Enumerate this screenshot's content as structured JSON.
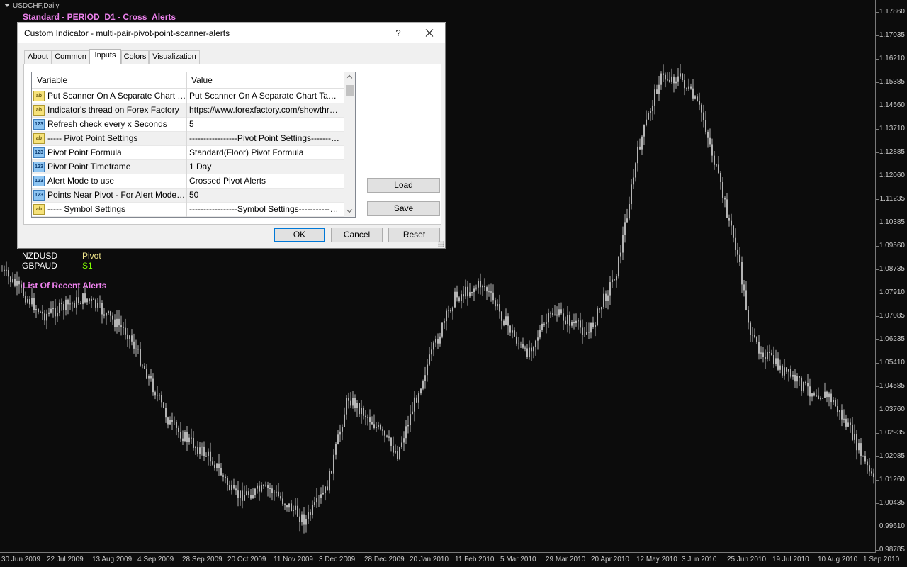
{
  "chart": {
    "symbol_tab": "USDCHF,Daily",
    "indicator_title": "Standard - PERIOD_D1 - Cross_Alerts",
    "scanner_rows": [
      {
        "symbol": "NZDUSD",
        "level": "Pivot",
        "level_color": "#f0e68c"
      },
      {
        "symbol": "GBPAUD",
        "level": "S1",
        "level_color": "#7fff00"
      }
    ],
    "recent_alerts_label": "List Of Recent Alerts",
    "price_labels": [
      "1.17860",
      "1.17035",
      "1.16210",
      "1.15385",
      "1.14560",
      "1.13710",
      "1.12885",
      "1.12060",
      "1.11235",
      "1.10385",
      "1.09560",
      "1.08735",
      "1.07910",
      "1.07085",
      "1.06235",
      "1.05410",
      "1.04585",
      "1.03760",
      "1.02935",
      "1.02085",
      "1.01260",
      "1.00435",
      "0.99610",
      "0.98785"
    ],
    "time_labels": [
      "30 Jun 2009",
      "22 Jul 2009",
      "13 Aug 2009",
      "4 Sep 2009",
      "28 Sep 2009",
      "20 Oct 2009",
      "11 Nov 2009",
      "3 Dec 2009",
      "28 Dec 2009",
      "20 Jan 2010",
      "11 Feb 2010",
      "5 Mar 2010",
      "29 Mar 2010",
      "20 Apr 2010",
      "12 May 2010",
      "3 Jun 2010",
      "25 Jun 2010",
      "19 Jul 2010",
      "10 Aug 2010",
      "1 Sep 2010"
    ],
    "colors": {
      "background": "#0c0c0c",
      "candle": "#b4b4b4",
      "axis_text": "#c8c8c8",
      "title": "#ee82ee"
    }
  },
  "dialog": {
    "title": "Custom Indicator - multi-pair-pivot-point-scanner-alerts",
    "help_label": "?",
    "tabs": [
      {
        "label": "About",
        "active": false
      },
      {
        "label": "Common",
        "active": false
      },
      {
        "label": "Inputs",
        "active": true
      },
      {
        "label": "Colors",
        "active": false
      },
      {
        "label": "Visualization",
        "active": false
      }
    ],
    "grid": {
      "col_variable": "Variable",
      "col_value": "Value",
      "rows": [
        {
          "type": "ab",
          "variable": "Put Scanner On A Separate Chart Tab...",
          "value": "Put Scanner On A Separate Chart Tab Fro..."
        },
        {
          "type": "ab",
          "variable": "Indicator's thread on Forex Factory",
          "value": "https://www.forexfactory.com/showthread..."
        },
        {
          "type": "123",
          "variable": "Refresh check every x Seconds",
          "value": "5"
        },
        {
          "type": "ab",
          "variable": "----- Pivot Point Settings",
          "value": "-----------------Pivot Point Settings-------------------..."
        },
        {
          "type": "123",
          "variable": "Pivot Point Formula",
          "value": "Standard(Floor) Pivot Formula"
        },
        {
          "type": "123",
          "variable": "Pivot Point Timeframe",
          "value": "1 Day"
        },
        {
          "type": "123",
          "variable": "Alert Mode to use",
          "value": "Crossed Pivot Alerts"
        },
        {
          "type": "123",
          "variable": "Points Near Pivot - For Alert Mode Near",
          "value": "50"
        },
        {
          "type": "ab",
          "variable": "----- Symbol Settings",
          "value": "-----------------Symbol Settings-----------------------..."
        }
      ]
    },
    "load_label": "Load",
    "save_label": "Save",
    "ok_label": "OK",
    "cancel_label": "Cancel",
    "reset_label": "Reset"
  }
}
